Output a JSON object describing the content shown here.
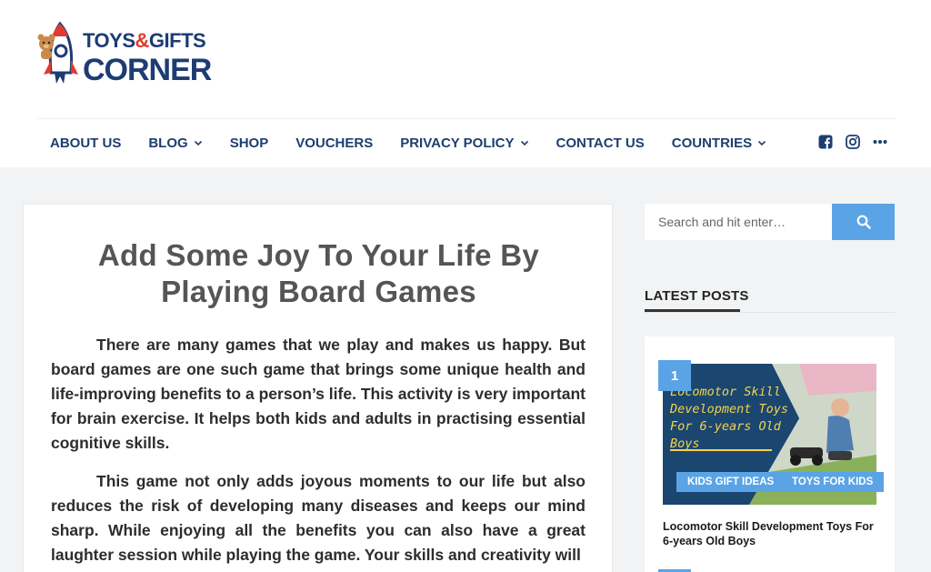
{
  "logo": {
    "line1a": "TOYS",
    "amp": "&",
    "line1b": "GIFTS",
    "line2": "CORNER"
  },
  "nav": {
    "items": [
      {
        "label": "ABOUT US",
        "dropdown": false
      },
      {
        "label": "BLOG",
        "dropdown": true
      },
      {
        "label": "SHOP",
        "dropdown": false
      },
      {
        "label": "VOUCHERS",
        "dropdown": false
      },
      {
        "label": "PRIVACY POLICY",
        "dropdown": true
      },
      {
        "label": "CONTACT US",
        "dropdown": false
      },
      {
        "label": "COUNTRIES",
        "dropdown": true
      }
    ],
    "social_icons": [
      "facebook-icon",
      "instagram-icon",
      "more-dots-icon"
    ]
  },
  "article": {
    "title": "Add Some Joy To Your Life By Playing Board Games",
    "paragraphs": [
      "There are many games that we play and makes us happy. But board games are one such game that brings some unique health and life-improving benefits to a person’s life. This activity is very important for brain exercise. It helps both kids and adults in practising essential cognitive skills.",
      "This game not only adds joyous moments to our life but also reduces the risk of developing many diseases and keeps our mind sharp. While enjoying all the benefits you can also have a great laughter session while playing the game. Your skills and creativity will"
    ]
  },
  "search": {
    "placeholder": "Search and hit enter…",
    "icon": "search-icon"
  },
  "sidebar": {
    "latest_heading": "LATEST POSTS",
    "posts": [
      {
        "rank": "1",
        "thumb_text": "Locomotor Skill Development Toys For 6-years Old Boys",
        "tags": [
          "KIDS GIFT IDEAS",
          "TOYS FOR KIDS"
        ],
        "title": "Locomotor Skill Development Toys For 6-years Old Boys"
      }
    ]
  },
  "colors": {
    "nav_text": "#1e3e6f",
    "accent": "#5aa4e6",
    "title_grey": "#555555",
    "logo_red": "#e13a2f"
  }
}
